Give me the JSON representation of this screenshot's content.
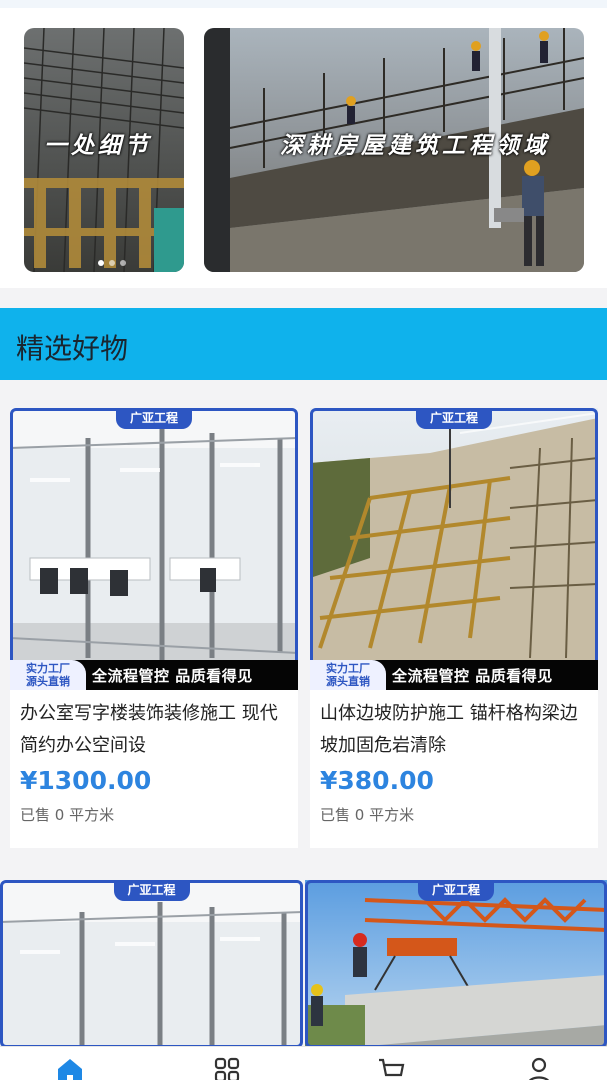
{
  "banner": {
    "slides": [
      {
        "caption": "一处细节"
      },
      {
        "caption": "深耕房屋建筑工程领域"
      }
    ],
    "dot_count": 3,
    "active_dot": 0
  },
  "section": {
    "title": "精选好物"
  },
  "products": [
    {
      "brand": "广亚工程",
      "badge_line1": "实力工厂",
      "badge_line2": "源头直销",
      "promo": "全流程管控 品质看得见",
      "title": "办公室写字楼装饰装修施工 现代简约办公空间设",
      "price": "¥1300.00",
      "sold": "已售 0 平方米"
    },
    {
      "brand": "广亚工程",
      "badge_line1": "实力工厂",
      "badge_line2": "源头直销",
      "promo": "全流程管控 品质看得见",
      "title": "山体边坡防护施工 锚杆格构梁边坡加固危岩清除",
      "price": "¥380.00",
      "sold": "已售 0 平方米"
    },
    {
      "brand": "广亚工程"
    },
    {
      "brand": "广亚工程"
    }
  ],
  "tabbar": {
    "tabs": [
      {
        "icon": "home-icon",
        "active": true
      },
      {
        "icon": "category-icon",
        "active": false
      },
      {
        "icon": "cart-icon",
        "active": false
      },
      {
        "icon": "user-icon",
        "active": false
      }
    ],
    "active_color": "#1e88e5",
    "inactive_color": "#333333"
  },
  "colors": {
    "accent": "#0fb2ec",
    "price": "#2d84df",
    "frame": "#2d56c2"
  }
}
